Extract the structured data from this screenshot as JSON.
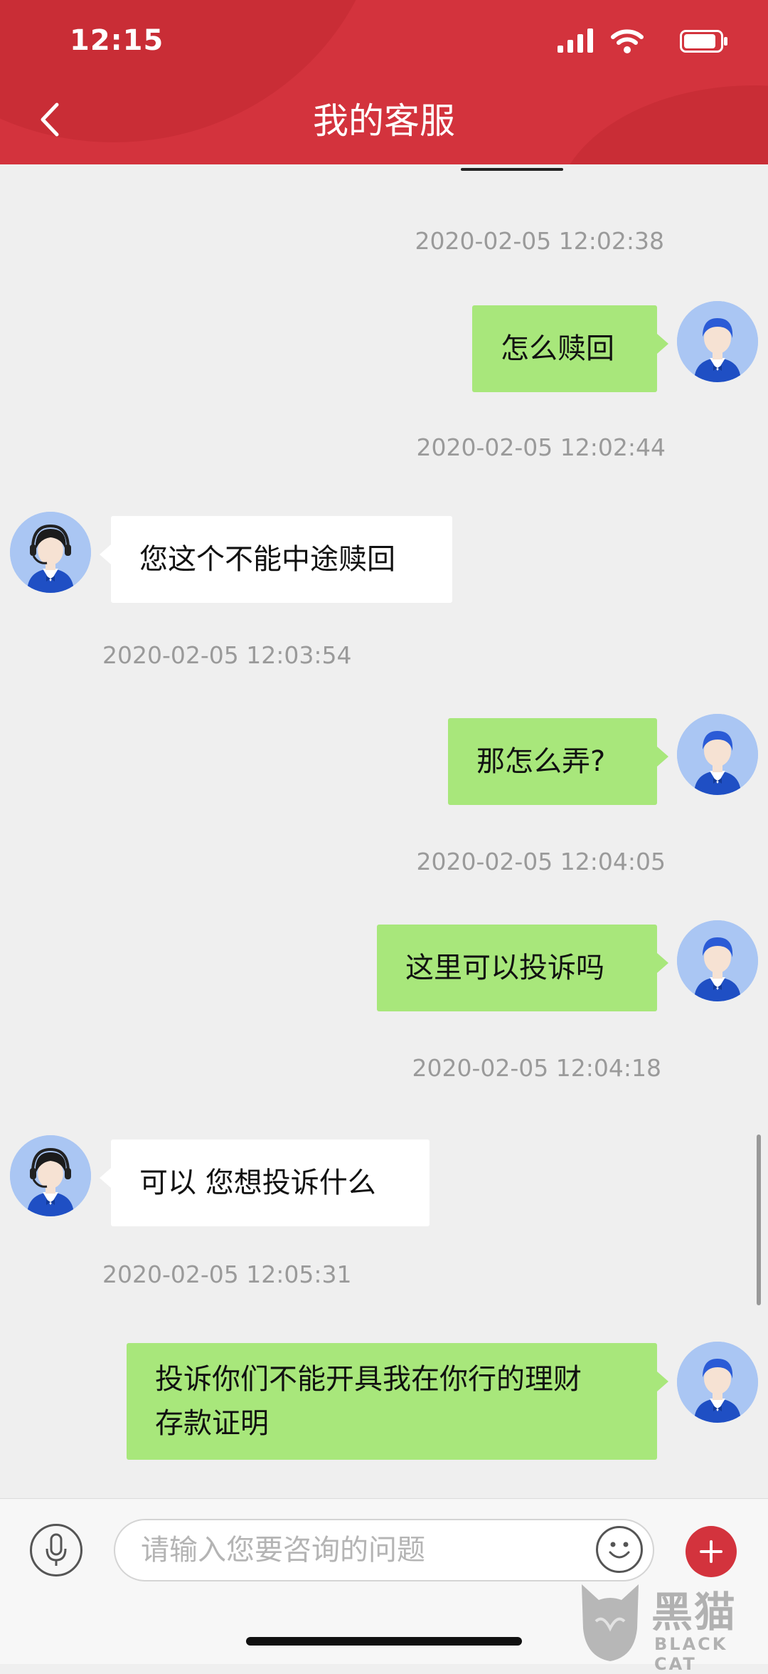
{
  "status_bar": {
    "time": "12:15"
  },
  "header": {
    "title": "我的客服"
  },
  "colors": {
    "brand": "#d3333d",
    "user_bubble": "#a8e77b",
    "agent_bubble": "#ffffff",
    "background": "#efefef"
  },
  "messages": [
    {
      "timestamp": "2020-02-05 12:02:38",
      "sender": "user",
      "lines": [
        "怎么赎回"
      ]
    },
    {
      "timestamp": "2020-02-05 12:02:44",
      "sender": "agent",
      "lines": [
        "您这个不能中途赎回"
      ]
    },
    {
      "timestamp": "2020-02-05 12:03:54",
      "sender": "user",
      "lines": [
        "那怎么弄?"
      ]
    },
    {
      "timestamp": "2020-02-05 12:04:05",
      "sender": "user",
      "lines": [
        "这里可以投诉吗"
      ]
    },
    {
      "timestamp": "2020-02-05 12:04:18",
      "sender": "agent",
      "lines": [
        "可以 您想投诉什么"
      ]
    },
    {
      "timestamp": "2020-02-05 12:05:31",
      "sender": "user",
      "lines": [
        "投诉你们不能开具我在你行的理财",
        "存款证明"
      ]
    }
  ],
  "input": {
    "placeholder": "请输入您要咨询的问题",
    "value": ""
  },
  "icons": {
    "back": "chevron-left-icon",
    "voice": "microphone-icon",
    "emoji": "smiley-icon",
    "add": "plus-icon",
    "user_avatar": "user-avatar",
    "agent_avatar": "customer-service-avatar"
  },
  "watermark": {
    "cn": "黑猫",
    "en": "BLACK CAT"
  }
}
